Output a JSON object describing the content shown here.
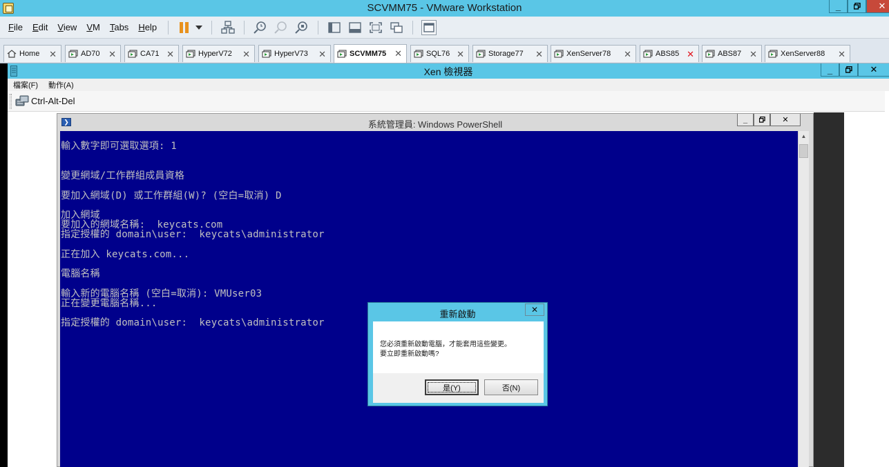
{
  "vmware": {
    "title": "SCVMM75 - VMware Workstation",
    "menu": [
      {
        "label": "File",
        "key": "F",
        "rest": "ile"
      },
      {
        "label": "Edit",
        "key": "E",
        "rest": "dit"
      },
      {
        "label": "View",
        "key": "V",
        "rest": "iew"
      },
      {
        "label": "VM",
        "key": "V",
        "rest": "M"
      },
      {
        "label": "Tabs",
        "key": "T",
        "rest": "abs"
      },
      {
        "label": "Help",
        "key": "H",
        "rest": "elp"
      }
    ],
    "tabs": [
      {
        "label": "Home"
      },
      {
        "label": "AD70"
      },
      {
        "label": "CA71"
      },
      {
        "label": "HyperV72"
      },
      {
        "label": "HyperV73"
      },
      {
        "label": "SCVMM75"
      },
      {
        "label": "SQL76"
      },
      {
        "label": "Storage77"
      },
      {
        "label": "XenServer78"
      },
      {
        "label": "ABS85"
      },
      {
        "label": "ABS87"
      },
      {
        "label": "XenServer88"
      }
    ],
    "active_tab": "SCVMM75",
    "accent_color": "#5ac6e6"
  },
  "xen": {
    "title": "Xen 檢視器",
    "menu_file": "檔案(F)",
    "menu_action": "動作(A)",
    "cad_label": "Ctrl-Alt-Del"
  },
  "powershell": {
    "title": "系統管理員: Windows PowerShell",
    "background_color": "#00008b",
    "lines": {
      "l1": "輸入數字即可選取選項: 1",
      "l2": "變更網域/工作群組成員資格",
      "l3": "要加入網域(D) 或工作群組(W)? (空白=取消) D",
      "l4": "加入網域",
      "l5": "要加入的網域名稱:  keycats.com",
      "l6": "指定授權的 domain\\user:  keycats\\administrator",
      "l7": "正在加入 keycats.com...",
      "l8": "電腦名稱",
      "l9": "輸入新的電腦名稱 (空白=取消): VMUser03",
      "l10": "正在變更電腦名稱...",
      "l11": "指定授權的 domain\\user:  keycats\\administrator"
    }
  },
  "dialog": {
    "title": "重新啟動",
    "message_line1": "您必須重新啟動電腦，才能套用這些變更。",
    "message_line2": "要立即重新啟動嗎?",
    "yes_label": "是(Y)",
    "no_label": "否(N)"
  }
}
